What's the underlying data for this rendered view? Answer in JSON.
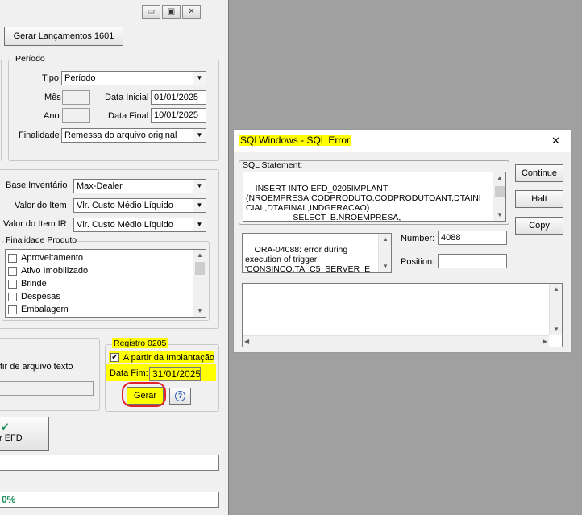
{
  "left_window": {
    "title_buttons": {
      "minimize": "▭",
      "maximize": "▣",
      "close": "✕"
    },
    "gerar_lancamentos_button": "Gerar Lançamentos 1601",
    "periodo": {
      "legend": "Período",
      "tipo_label": "Tipo",
      "tipo_value": "Período",
      "mes_label": "Mês",
      "ano_label": "Ano",
      "data_inicial_label": "Data Inicial",
      "data_inicial_value": "01/01/2025",
      "data_final_label": "Data Final",
      "data_final_value": "10/01/2025",
      "finalidade_label": "Finalidade",
      "finalidade_value": "Remessa do arquivo original"
    },
    "inventario": {
      "base_label": "Base Inventário",
      "base_value": "Max-Dealer",
      "valor_item_label": "Valor do Item",
      "valor_item_value": "Vlr. Custo Médio Líquido",
      "valor_item_ir_label": "Valor do Item IR",
      "valor_item_ir_value": "Vlr. Custo Médio Líquido",
      "finalidade_produto_legend": "Finalidade Produto",
      "finalidade_items": [
        "Aproveitamento",
        "Ativo Imobilizado",
        "Brinde",
        "Despesas",
        "Embalagem"
      ]
    },
    "arquivo_texto_label": "tir de arquivo texto",
    "registro_0205": {
      "legend": "Registro 0205",
      "checkbox_label": "A partir da Implantação",
      "checkbox_checked": true,
      "data_fim_label": "Data Fim:",
      "data_fim_value": "31/01/2025",
      "gerar_button": "Gerar",
      "help_icon": "?"
    },
    "gerar_efd_button": "r EFD",
    "gerar_efd_icon": "✓",
    "progress_text": "0%"
  },
  "sql_dialog": {
    "title": "SQLWindows - SQL Error",
    "close_icon": "✕",
    "sql_statement_label": "SQL Statement:",
    "sql_statement": "INSERT INTO EFD_0205IMPLANT\n(NROEMPRESA,CODPRODUTO,CODPRODUTOANT,DTAINI\nCIAL,DTAFINAL,INDGERACAO)\n                    SELECT  B.NROEMPRESA,",
    "error_message": "ORA-04088: error during\nexecution of trigger\n'CONSINCO.TA_C5_SERVER_E",
    "number_label": "Number:",
    "number_value": "4088",
    "position_label": "Position:",
    "position_value": "",
    "details_text": "",
    "buttons": {
      "continue": "Continue",
      "halt": "Halt",
      "copy": "Copy"
    }
  },
  "colors": {
    "highlight": "#ffff00",
    "annotation_circle": "#e0202a",
    "progress_text": "#1a8a5a"
  }
}
